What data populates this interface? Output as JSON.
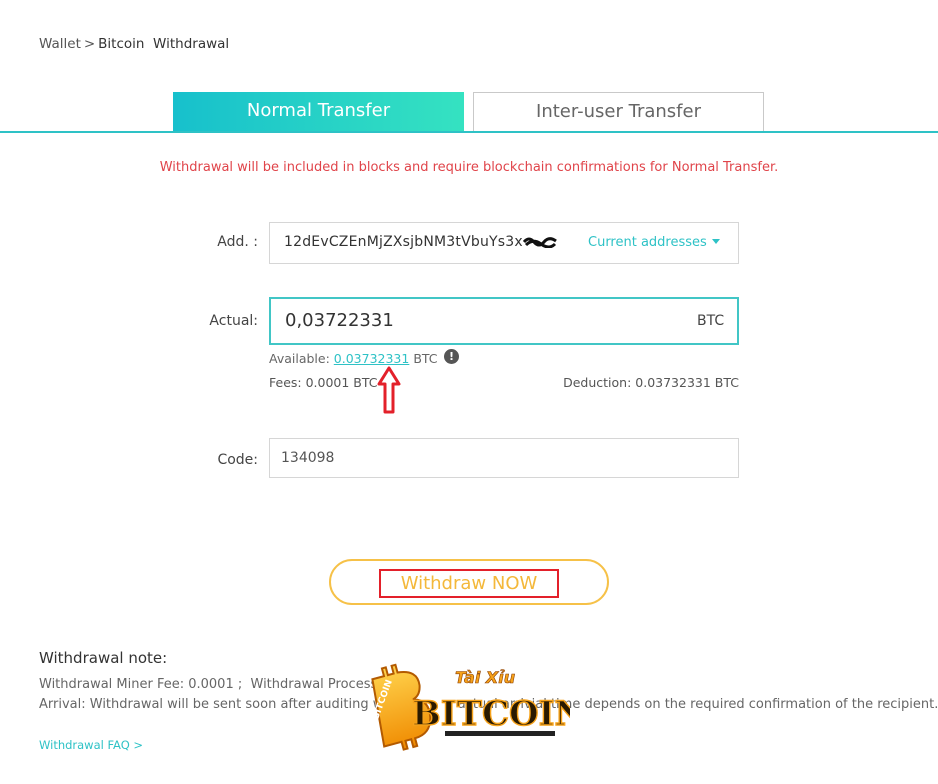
{
  "breadcrumb": {
    "root": "Wallet",
    "separator": ">",
    "current": "Bitcoin  Withdrawal"
  },
  "tabs": {
    "normal": "Normal Transfer",
    "inter_user": "Inter-user Transfer",
    "active": "normal"
  },
  "notice": "Withdrawal will be included in blocks and require blockchain confirmations for Normal Transfer.",
  "form": {
    "address_label": "Add. :",
    "address_value": "12dEvCZEnMjZXsjbNM3tVbuYs3x",
    "address_dropdown": "Current addresses",
    "actual_label": "Actual:",
    "actual_value": "0,03722331",
    "actual_unit": "BTC",
    "available_prefix": "Available:",
    "available_amount": "0.03732331",
    "available_unit": "BTC",
    "info_glyph": "!",
    "fees": "Fees: 0.0001 BTC",
    "deduction": "Deduction: 0.03732331 BTC",
    "code_label": "Code:",
    "code_value": "134098"
  },
  "withdraw_button": "Withdraw NOW",
  "notes": {
    "title": "Withdrawal note:",
    "line1": "Withdrawal Miner Fee: 0.0001 ;  Withdrawal Process F",
    "line2": "Arrival: Withdrawal will be sent soon after auditing w                  actual arrivial time depends on the required confirmation of the recipient.",
    "faq": "Withdrawal FAQ >"
  },
  "watermark": {
    "top": "Tài Xỉu",
    "main": "BITCOIN",
    "badge": "BITCOIN"
  },
  "colors": {
    "accent": "#2ec2c6",
    "warning": "#e0444a",
    "button_border": "#f6c148",
    "highlight_red": "#e3202a"
  }
}
